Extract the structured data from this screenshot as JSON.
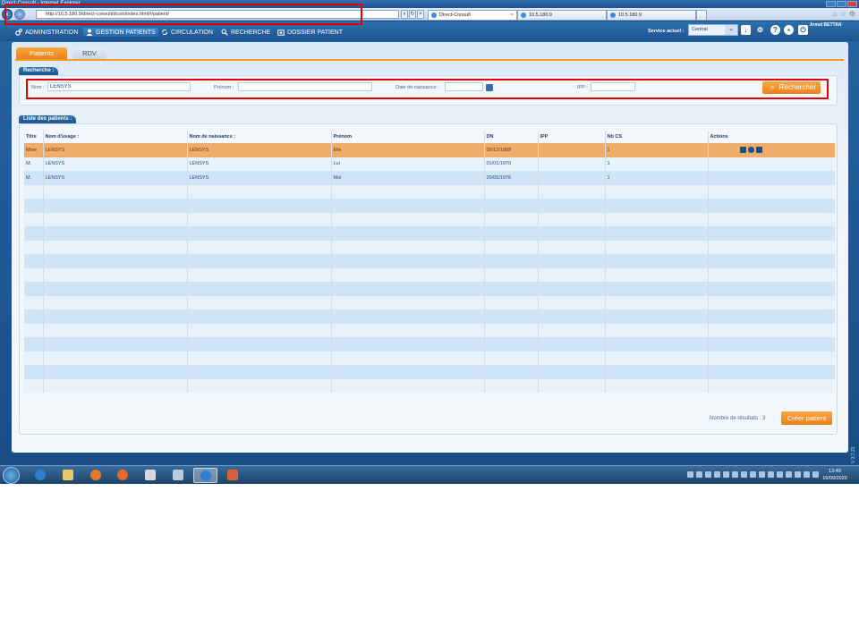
{
  "window": {
    "title": "Direct-Consult - Internet Explorer",
    "address": "http://10.5.180.9/direct-consult/dcoin/index.html#/patient/",
    "tabs": [
      {
        "label": "Direct-Consult",
        "active": true
      },
      {
        "label": "10.5.180.9",
        "active": false
      },
      {
        "label": "10.5.180.9",
        "active": false
      }
    ]
  },
  "nav": {
    "items": [
      {
        "label": "ADMINISTRATION",
        "icon": "gears-icon"
      },
      {
        "label": "GESTION PATIENTS",
        "icon": "user-icon",
        "active": true
      },
      {
        "label": "CIRCULATION",
        "icon": "refresh-icon"
      },
      {
        "label": "RECHERCHE",
        "icon": "search-icon"
      },
      {
        "label": "DOSSIER PATIENT",
        "icon": "folder-icon"
      }
    ],
    "service_label": "Service actuel :",
    "service_value": "Central",
    "user_name": "Armel BETTAN"
  },
  "subtabs": {
    "patients": "Patients",
    "rdv": "RDV"
  },
  "search": {
    "section_title": "Recherche :",
    "nom_label": "Nom :",
    "nom_value": "LENSYS",
    "prenom_label": "Prénom :",
    "prenom_value": "",
    "dob_label": "Date de naissance :",
    "dob_value": "",
    "ipp_label": "IPP :",
    "ipp_value": "",
    "button_label": "Rechercher"
  },
  "patients": {
    "section_title": "Liste des patients :",
    "columns": [
      "Titre",
      "Nom d'usage :",
      "Nom de naissance :",
      "Prénom",
      "DN",
      "IPP",
      "Nb CS",
      "Actions"
    ],
    "rows": [
      {
        "titre": "Mme",
        "nom_usage": "LENSYS",
        "nom_naissance": "LENSYS",
        "prenom": "Elle",
        "dn": "09/12/1989",
        "ipp": "",
        "nb_cs": "1",
        "selected": true
      },
      {
        "titre": "M.",
        "nom_usage": "LENSYS",
        "nom_naissance": "LENSYS",
        "prenom": "Lui",
        "dn": "01/01/1970",
        "ipp": "",
        "nb_cs": "1",
        "selected": false
      },
      {
        "titre": "M.",
        "nom_usage": "LENSYS",
        "nom_naissance": "LENSYS",
        "prenom": "Moi",
        "dn": "20/05/1976",
        "ipp": "",
        "nb_cs": "1",
        "selected": false
      }
    ],
    "results_label": "Nombre de résultats :",
    "results_count": "3",
    "create_button": "Créer patient"
  },
  "version": "V 3.7.21",
  "clock": {
    "time": "13:49",
    "date": "16/09/2020"
  },
  "colors": {
    "accent_orange": "#f39a2a",
    "primary_blue": "#1d548f",
    "highlight_red": "#e10000"
  }
}
